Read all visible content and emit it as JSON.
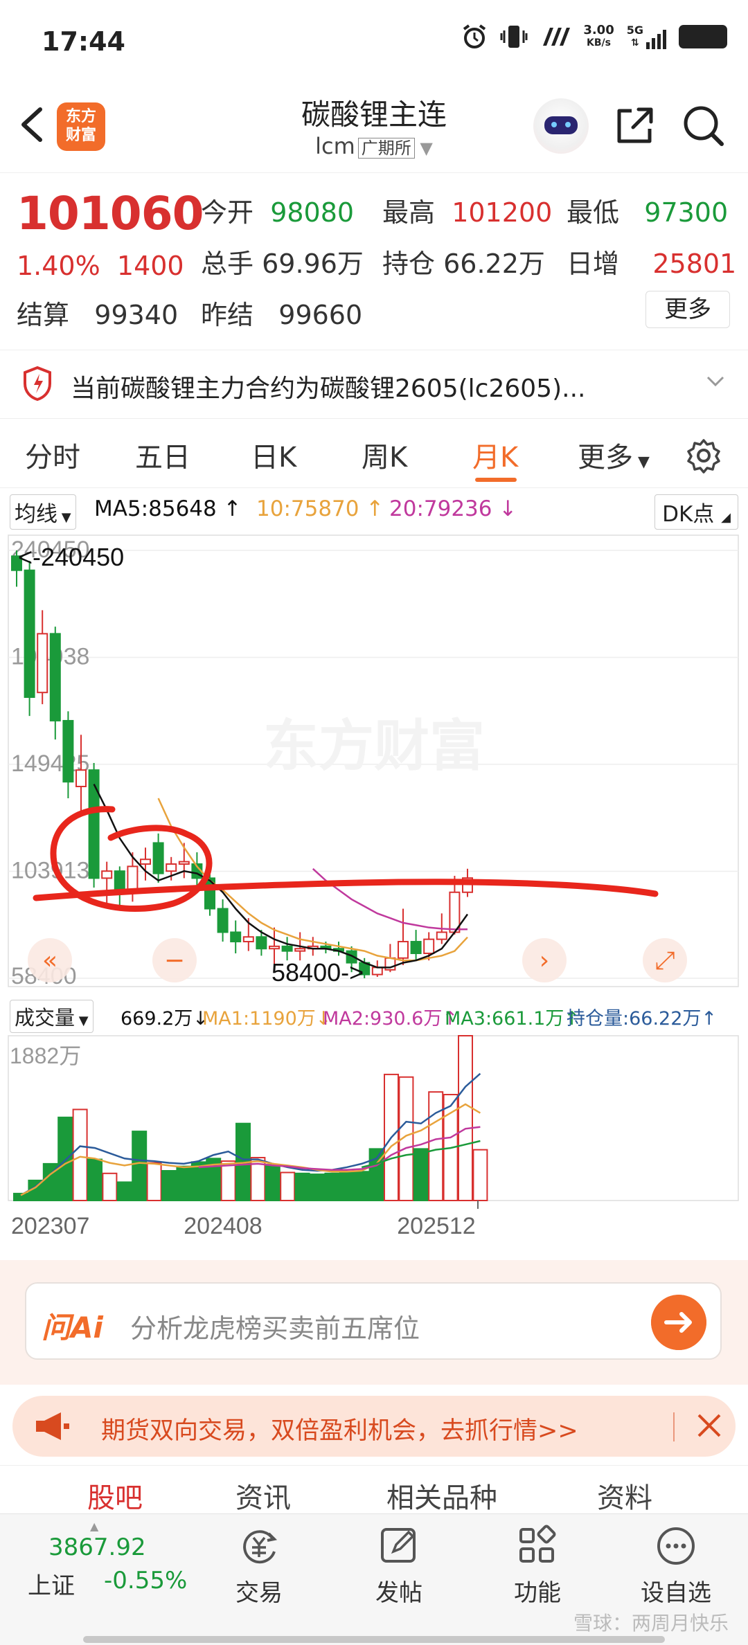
{
  "status_bar": {
    "time": "17:44",
    "net_speed": "3.00",
    "net_unit": "KB/s",
    "net_type": "5G"
  },
  "header": {
    "title": "碳酸锂主连",
    "code": "lcm",
    "exchange": "广期所",
    "logo_text_1": "东方",
    "logo_text_2": "财富"
  },
  "quote": {
    "price": "101060",
    "change_pct": "1.40%",
    "change": "1400",
    "open_label": "今开",
    "open": "98080",
    "high_label": "最高",
    "high": "101200",
    "low_label": "最低",
    "low": "97300",
    "volume_label": "总手",
    "volume": "69.96万",
    "oi_label": "持仓",
    "oi": "66.22万",
    "daily_inc_label": "日增",
    "daily_inc": "25801",
    "settle_label": "结算",
    "settle": "99340",
    "prev_settle_label": "昨结",
    "prev_settle": "99660",
    "more": "更多"
  },
  "notice": {
    "text": "当前碳酸锂主力合约为碳酸锂2605(lc2605)..."
  },
  "tabs": [
    "分时",
    "五日",
    "日K",
    "周K",
    "月K",
    "更多"
  ],
  "active_tab": "月K",
  "indicator": {
    "selector": "均线",
    "ma5": "MA5:85648",
    "ma10": "10:75870",
    "ma20": "20:79236",
    "dk": "DK点"
  },
  "volume_indicator": {
    "selector": "成交量",
    "value": "669.2万",
    "ma1": "MA1:1190万",
    "ma2": "MA2:930.6万",
    "ma3": "MA3:661.1万",
    "oi": "持仓量:66.22万"
  },
  "colors": {
    "up": "#d8302f",
    "down": "#1a9a3a",
    "accent": "#f26c2a",
    "ma5": "#111111",
    "ma10": "#e8a33c",
    "ma20": "#c0399d",
    "annotation": "#e8261c"
  },
  "chart_data": [
    {
      "type": "candlestick",
      "period": "monthly",
      "y_tick_labels": [
        "240450",
        "194938",
        "149425",
        "103913",
        "58400"
      ],
      "ylim": [
        58400,
        240450
      ],
      "high_marker": "240450",
      "low_marker": "58400",
      "candles": [
        {
          "o": 238000,
          "c": 232000,
          "h": 240450,
          "l": 225000
        },
        {
          "o": 232000,
          "c": 178000,
          "h": 236000,
          "l": 170000
        },
        {
          "o": 180000,
          "c": 205000,
          "h": 215000,
          "l": 175000
        },
        {
          "o": 205000,
          "c": 168000,
          "h": 208000,
          "l": 160000
        },
        {
          "o": 168000,
          "c": 142000,
          "h": 172000,
          "l": 135000
        },
        {
          "o": 140000,
          "c": 147000,
          "h": 162000,
          "l": 128000
        },
        {
          "o": 147000,
          "c": 101000,
          "h": 150000,
          "l": 97000
        },
        {
          "o": 101000,
          "c": 104000,
          "h": 108000,
          "l": 90000
        },
        {
          "o": 104000,
          "c": 96000,
          "h": 106000,
          "l": 88000
        },
        {
          "o": 96000,
          "c": 106000,
          "h": 112000,
          "l": 91000
        },
        {
          "o": 107000,
          "c": 109000,
          "h": 114000,
          "l": 100000
        },
        {
          "o": 116000,
          "c": 103000,
          "h": 120000,
          "l": 99000
        },
        {
          "o": 104000,
          "c": 107000,
          "h": 110000,
          "l": 100000
        },
        {
          "o": 107000,
          "c": 108000,
          "h": 116000,
          "l": 101000
        },
        {
          "o": 107000,
          "c": 101000,
          "h": 112000,
          "l": 98000
        },
        {
          "o": 101000,
          "c": 88000,
          "h": 104000,
          "l": 85000
        },
        {
          "o": 88000,
          "c": 78000,
          "h": 92000,
          "l": 74000
        },
        {
          "o": 78000,
          "c": 74000,
          "h": 83000,
          "l": 69000
        },
        {
          "o": 74000,
          "c": 76000,
          "h": 84000,
          "l": 70000
        },
        {
          "o": 76000,
          "c": 71000,
          "h": 79000,
          "l": 68000
        },
        {
          "o": 71000,
          "c": 72000,
          "h": 80000,
          "l": 63000
        },
        {
          "o": 72000,
          "c": 70000,
          "h": 76000,
          "l": 66000
        },
        {
          "o": 70000,
          "c": 71000,
          "h": 78000,
          "l": 66000
        },
        {
          "o": 71000,
          "c": 72000,
          "h": 76000,
          "l": 68000
        },
        {
          "o": 72000,
          "c": 71000,
          "h": 74000,
          "l": 69000
        },
        {
          "o": 71000,
          "c": 70000,
          "h": 74000,
          "l": 68000
        },
        {
          "o": 70000,
          "c": 65000,
          "h": 72000,
          "l": 61000
        },
        {
          "o": 65000,
          "c": 60000,
          "h": 67000,
          "l": 58400
        },
        {
          "o": 60000,
          "c": 63000,
          "h": 66000,
          "l": 59000
        },
        {
          "o": 62000,
          "c": 67000,
          "h": 73000,
          "l": 61000
        },
        {
          "o": 67000,
          "c": 74000,
          "h": 88000,
          "l": 64000
        },
        {
          "o": 74000,
          "c": 69000,
          "h": 79000,
          "l": 66000
        },
        {
          "o": 69000,
          "c": 75000,
          "h": 78000,
          "l": 66000
        },
        {
          "o": 75000,
          "c": 78000,
          "h": 86000,
          "l": 73000
        },
        {
          "o": 78000,
          "c": 95000,
          "h": 102000,
          "l": 77000
        },
        {
          "o": 95000,
          "c": 101060,
          "h": 105000,
          "l": 93000
        }
      ],
      "ma5": [
        null,
        null,
        null,
        null,
        null,
        null,
        141000,
        130000,
        118000,
        110000,
        104000,
        100000,
        102000,
        104000,
        103000,
        100000,
        95000,
        88000,
        82000,
        78000,
        75000,
        73000,
        72000,
        71000,
        71000,
        70000,
        68000,
        65000,
        63000,
        63000,
        65000,
        66000,
        68000,
        71000,
        78000,
        85648
      ],
      "ma10": [
        null,
        null,
        null,
        null,
        null,
        null,
        null,
        null,
        null,
        null,
        null,
        null,
        null,
        null,
        null,
        null,
        null,
        null,
        null,
        null,
        null,
        null,
        null,
        null,
        null,
        null,
        null,
        null,
        null,
        null,
        null,
        null,
        null,
        null,
        null,
        null
      ],
      "ma10_visible": [
        null,
        null,
        null,
        null,
        null,
        null,
        null,
        null,
        null,
        null,
        null,
        null,
        null,
        null,
        null,
        null,
        null,
        null,
        null,
        null,
        null,
        null,
        null,
        null,
        null,
        null,
        null,
        null,
        null,
        null,
        null,
        null,
        null,
        null,
        null,
        null
      ],
      "ma10_series": [
        null,
        null,
        null,
        null,
        null,
        null,
        null,
        null,
        null,
        null,
        null,
        135000,
        123000,
        114000,
        106000,
        100000,
        96000,
        91000,
        86000,
        82000,
        79000,
        77000,
        75000,
        74000,
        73000,
        72000,
        71000,
        70000,
        68000,
        67000,
        66000,
        66000,
        67000,
        68000,
        70000,
        75870
      ],
      "ma20_series": [
        null,
        null,
        null,
        null,
        null,
        null,
        null,
        null,
        null,
        null,
        null,
        null,
        null,
        null,
        null,
        null,
        null,
        null,
        null,
        null,
        null,
        null,
        null,
        105000,
        100000,
        96000,
        92000,
        89000,
        86000,
        84000,
        82000,
        81000,
        80000,
        79500,
        79200,
        79236
      ]
    },
    {
      "type": "bar",
      "title": "成交量",
      "y_tick_labels": [
        "1882万"
      ],
      "x_tick_labels": [
        "202307",
        "202408",
        "202512"
      ],
      "values": [
        80,
        230,
        420,
        950,
        1040,
        470,
        310,
        210,
        790,
        430,
        340,
        390,
        440,
        480,
        450,
        880,
        490,
        410,
        320,
        310,
        300,
        310,
        320,
        330,
        590,
        1440,
        1410,
        590,
        1240,
        1210,
        1882,
        580
      ],
      "up": [
        false,
        false,
        false,
        false,
        true,
        false,
        true,
        false,
        false,
        true,
        false,
        false,
        false,
        false,
        true,
        false,
        true,
        false,
        true,
        false,
        false,
        false,
        false,
        false,
        false,
        true,
        true,
        false,
        true,
        true,
        true,
        true
      ],
      "ma_lines": {
        "blue": [
          60,
          160,
          300,
          460,
          620,
          600,
          540,
          480,
          460,
          450,
          430,
          420,
          450,
          520,
          560,
          470,
          470,
          420,
          380,
          350,
          340,
          350,
          380,
          420,
          480,
          720,
          900,
          880,
          1000,
          1080,
          1300,
          1450
        ],
        "orange": [
          60,
          150,
          300,
          420,
          500,
          480,
          430,
          400,
          430,
          420,
          400,
          380,
          390,
          410,
          420,
          430,
          450,
          420,
          400,
          380,
          350,
          330,
          330,
          340,
          420,
          620,
          740,
          800,
          900,
          1000,
          1100,
          1000
        ],
        "pink": [
          null,
          null,
          null,
          null,
          null,
          null,
          null,
          null,
          null,
          null,
          null,
          null,
          380,
          390,
          400,
          410,
          420,
          400,
          390,
          370,
          360,
          350,
          350,
          360,
          400,
          520,
          600,
          640,
          700,
          720,
          820,
          840
        ],
        "green": [
          null,
          null,
          null,
          null,
          null,
          null,
          null,
          null,
          null,
          null,
          null,
          null,
          null,
          null,
          null,
          null,
          null,
          null,
          null,
          null,
          null,
          null,
          null,
          380,
          420,
          480,
          520,
          540,
          580,
          600,
          640,
          680
        ]
      }
    }
  ],
  "ai_bar": {
    "logo": "问Ai",
    "placeholder": "分析龙虎榜买卖前五席位"
  },
  "promo": {
    "text": "期货双向交易，双倍盈利机会，去抓行情>>"
  },
  "bottom_tabs": [
    "股吧",
    "资讯",
    "相关品种",
    "资料"
  ],
  "index": {
    "value": "3867.92",
    "name": "上证",
    "change": "-0.55%"
  },
  "bottom_nav": [
    "交易",
    "发帖",
    "功能",
    "设自选"
  ],
  "watermark": "雪球：两周月快乐"
}
